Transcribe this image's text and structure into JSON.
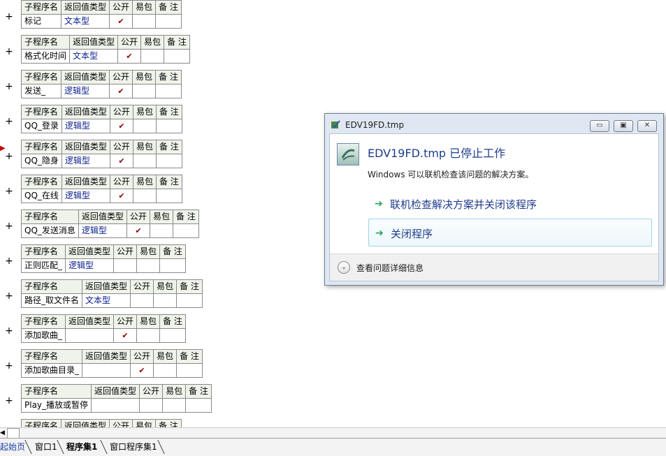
{
  "headers": {
    "name": "子程序名",
    "rtype": "返回值类型",
    "pub": "公开",
    "easy": "易包",
    "note": "备 注"
  },
  "check_glyph": "✔",
  "plus_glyph": "+",
  "subs": [
    {
      "name": "标记",
      "rtype": "文本型",
      "public": true
    },
    {
      "name": "格式化时间",
      "rtype": "文本型",
      "public": true
    },
    {
      "name": "发送_",
      "rtype": "逻辑型",
      "public": true
    },
    {
      "name": "QQ_登录",
      "rtype": "逻辑型",
      "public": true
    },
    {
      "name": "QQ_隐身",
      "rtype": "逻辑型",
      "public": true
    },
    {
      "name": "QQ_在线",
      "rtype": "逻辑型",
      "public": true
    },
    {
      "name": "QQ_发送消息",
      "rtype": "逻辑型",
      "public": true
    },
    {
      "name": "正则匹配_",
      "rtype": "逻辑型",
      "public": false
    },
    {
      "name": "路径_取文件名",
      "rtype": "文本型",
      "public": false
    },
    {
      "name": "添加歌曲_",
      "rtype": "",
      "public": true
    },
    {
      "name": "添加歌曲目录_",
      "rtype": "",
      "public": true
    },
    {
      "name": "Play_播放或暂停",
      "rtype": "",
      "public": false
    }
  ],
  "tabs": [
    "起始页",
    "窗口1",
    "程序集1",
    "窗口程序集1"
  ],
  "active_tab": 2,
  "dialog": {
    "title": "EDV19FD.tmp",
    "heading": "EDV19FD.tmp 已停止工作",
    "subtext": "Windows 可以联机检查该问题的解决方案。",
    "option1": "联机检查解决方案并关闭该程序",
    "option2": "关闭程序",
    "details": "查看问题详细信息",
    "minimize": "▭",
    "restore": "▣",
    "close": "✕",
    "option_arrow": "➔",
    "chevron": "⌄"
  }
}
